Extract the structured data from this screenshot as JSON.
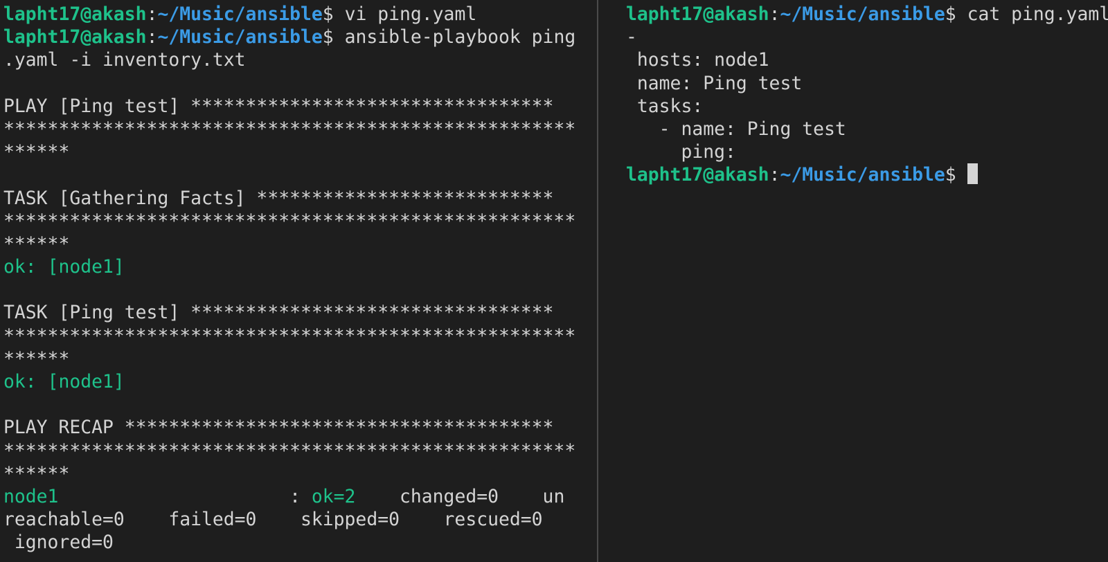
{
  "prompt": {
    "user_host": "lapht17@akash",
    "sep": ":",
    "path": "~/Music/ansible",
    "symbol": "$ "
  },
  "left_pane": {
    "cmd1": "vi ping.yaml",
    "cmd2_a": "ansible-playbook ping",
    "cmd2_b": ".yaml -i inventory.txt",
    "play_header": "PLAY [Ping test] *********************************",
    "stars_full": "****************************************************",
    "stars_tail": "******",
    "task1_header": "TASK [Gathering Facts] ***************************",
    "task1_ok": "ok: [node1]",
    "task2_header": "TASK [Ping test] *********************************",
    "task2_ok": "ok: [node1]",
    "recap_header": "PLAY RECAP ***************************************",
    "recap_host": "node1",
    "recap_pad": "                     : ",
    "recap_ok": "ok=2",
    "recap_rest1": "    changed=0    un",
    "recap_line2": "reachable=0    failed=0    skipped=0    rescued=0",
    "recap_line3": " ignored=0"
  },
  "right_pane": {
    "cmd": "cat ping.yaml",
    "yaml_lines": [
      "-",
      " hosts: node1",
      " name: Ping test",
      " tasks:",
      "   - name: Ping test",
      "     ping:"
    ]
  },
  "colors": {
    "background": "#1e1e1e",
    "text": "#d4d4d4",
    "user_green": "#1ec28b",
    "path_blue": "#3b9be6"
  }
}
